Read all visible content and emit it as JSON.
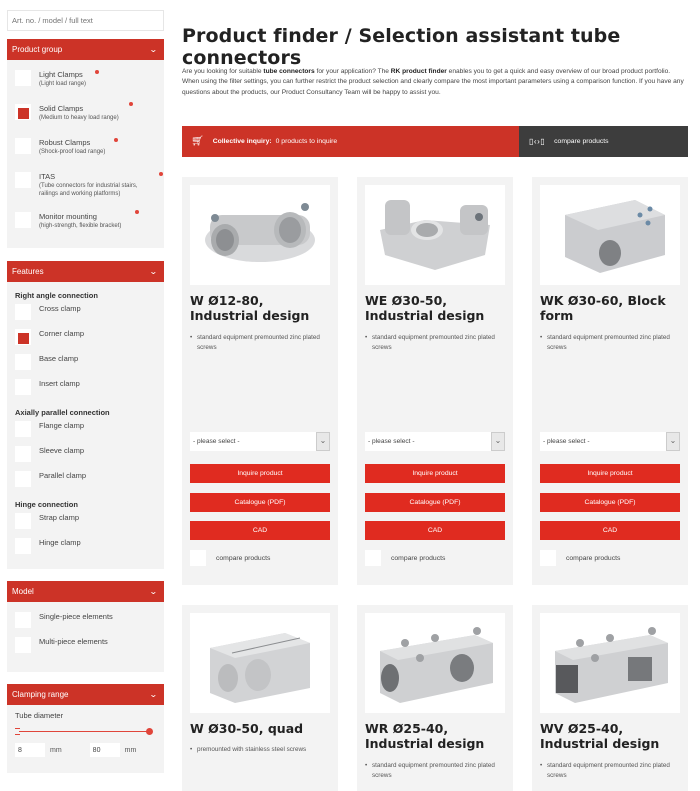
{
  "search": {
    "placeholder": "Art. no. / model / full text"
  },
  "panels": {
    "product_group": {
      "title": "Product group",
      "items": [
        {
          "label": "Light Clamps",
          "sub": "(Light load range)",
          "checked": false
        },
        {
          "label": "Solid Clamps",
          "sub": "(Medium to heavy load range)",
          "checked": true
        },
        {
          "label": "Robust Clamps",
          "sub": "(Shock-proof load range)",
          "checked": false
        },
        {
          "label": "ITAS",
          "sub": "(Tube connectors for industrial stairs, railings and working platforms)",
          "checked": false
        },
        {
          "label": "Monitor mounting",
          "sub": "(high-strength, flexible bracket)",
          "checked": false
        }
      ]
    },
    "features": {
      "title": "Features",
      "groups": [
        {
          "label": "Right angle connection",
          "items": [
            {
              "label": "Cross clamp",
              "checked": false
            },
            {
              "label": "Corner clamp",
              "checked": true
            },
            {
              "label": "Base clamp",
              "checked": false
            },
            {
              "label": "Insert clamp",
              "checked": false
            }
          ]
        },
        {
          "label": "Axially parallel connection",
          "items": [
            {
              "label": "Flange clamp",
              "checked": false
            },
            {
              "label": "Sleeve clamp",
              "checked": false
            },
            {
              "label": "Parallel clamp",
              "checked": false
            }
          ]
        },
        {
          "label": "Hinge connection",
          "items": [
            {
              "label": "Strap clamp",
              "checked": false
            },
            {
              "label": "Hinge clamp",
              "checked": false
            }
          ]
        }
      ]
    },
    "model": {
      "title": "Model",
      "items": [
        {
          "label": "Single-piece elements",
          "checked": false
        },
        {
          "label": "Multi-piece elements",
          "checked": false
        }
      ]
    },
    "clamping": {
      "title": "Clamping range",
      "label": "Tube diameter",
      "min": "8",
      "max": "80",
      "unit": "mm"
    }
  },
  "main": {
    "title": "Product finder / Selection assistant tube connectors",
    "intro": {
      "p1": "Are you looking for suitable ",
      "b1": "tube connectors",
      "p2": " for your application? The ",
      "b2": "RK product finder",
      "p3": " enables you to get a quick and easy overview of our broad product portfolio. When using the filter settings, you can further restrict the product selection and clearly compare the most important parameters using a comparison function. If you have any questions about the products, our Product Consultancy Team will be happy to assist you."
    },
    "bar": {
      "inquiry_label": "Collective inquiry:",
      "inquiry_value": "0 products to inquire",
      "compare_label": "compare products"
    },
    "card_labels": {
      "select_placeholder": "- please select -",
      "inquire": "Inquire product",
      "catalogue": "Catalogue (PDF)",
      "cad": "CAD",
      "compare": "compare products"
    },
    "products": [
      {
        "name": "W Ø12-80, Industrial design",
        "bullet": "standard equipment premounted zinc plated screws"
      },
      {
        "name": "WE Ø30-50, Industrial design",
        "bullet": "standard equipment premounted zinc plated screws"
      },
      {
        "name": "WK Ø30-60, Block form",
        "bullet": "standard equipment premounted zinc plated screws"
      },
      {
        "name": "W Ø30-50, quad",
        "bullet": "premounted with stainless steel screws"
      },
      {
        "name": "WR Ø25-40, Industrial design",
        "bullet": "standard equipment premounted zinc plated screws"
      },
      {
        "name": "WV Ø25-40, Industrial design",
        "bullet": "standard equipment premounted zinc plated screws"
      }
    ]
  },
  "colors": {
    "accent": "#cc3327",
    "button": "#e02b20",
    "dark": "#3d3d3d",
    "panel": "#f3f3f3"
  }
}
